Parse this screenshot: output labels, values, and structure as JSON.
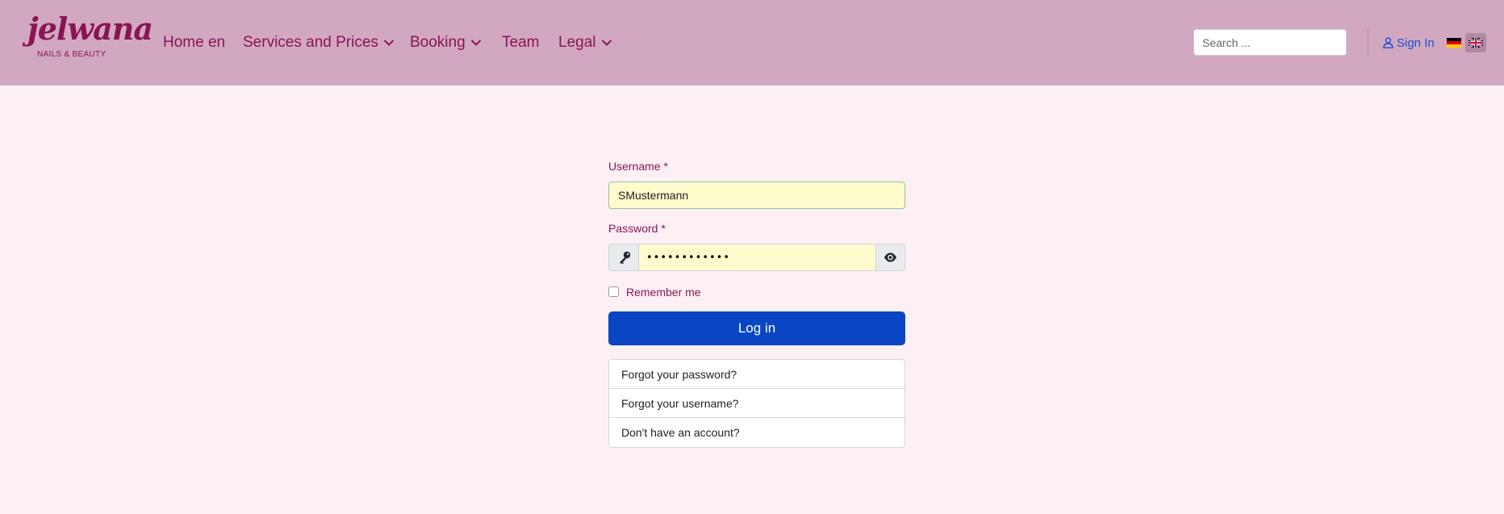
{
  "brand": {
    "logo_script": "jelwana",
    "logo_sub": "NAILS & BEAUTY"
  },
  "nav": {
    "items": [
      {
        "label": "Home en",
        "dropdown": false
      },
      {
        "label": "Services and Prices",
        "dropdown": true
      },
      {
        "label": "Booking",
        "dropdown": true
      },
      {
        "label": "Team",
        "dropdown": false
      },
      {
        "label": "Legal",
        "dropdown": true
      }
    ]
  },
  "search": {
    "placeholder": "Search ..."
  },
  "account": {
    "signin_label": "Sign In",
    "icon": "user-icon"
  },
  "languages": [
    {
      "code": "de",
      "icon": "flag-de-icon",
      "active": false
    },
    {
      "code": "en",
      "icon": "flag-gb-icon",
      "active": true
    }
  ],
  "form": {
    "username_label": "Username *",
    "username_value": "SMustermann",
    "password_label": "Password *",
    "password_value": "••••••••••••",
    "remember_label": "Remember me",
    "remember_checked": false,
    "login_label": "Log in",
    "links": [
      "Forgot your password?",
      "Forgot your username?",
      "Don't have an account?"
    ]
  },
  "colors": {
    "header_bg": "#d2a8c1",
    "page_bg": "#fdf0f5",
    "brand_text": "#8a1454",
    "primary_button": "#0a46c4",
    "link_blue": "#1b4fd4",
    "autofill_bg": "#fefbcd"
  }
}
